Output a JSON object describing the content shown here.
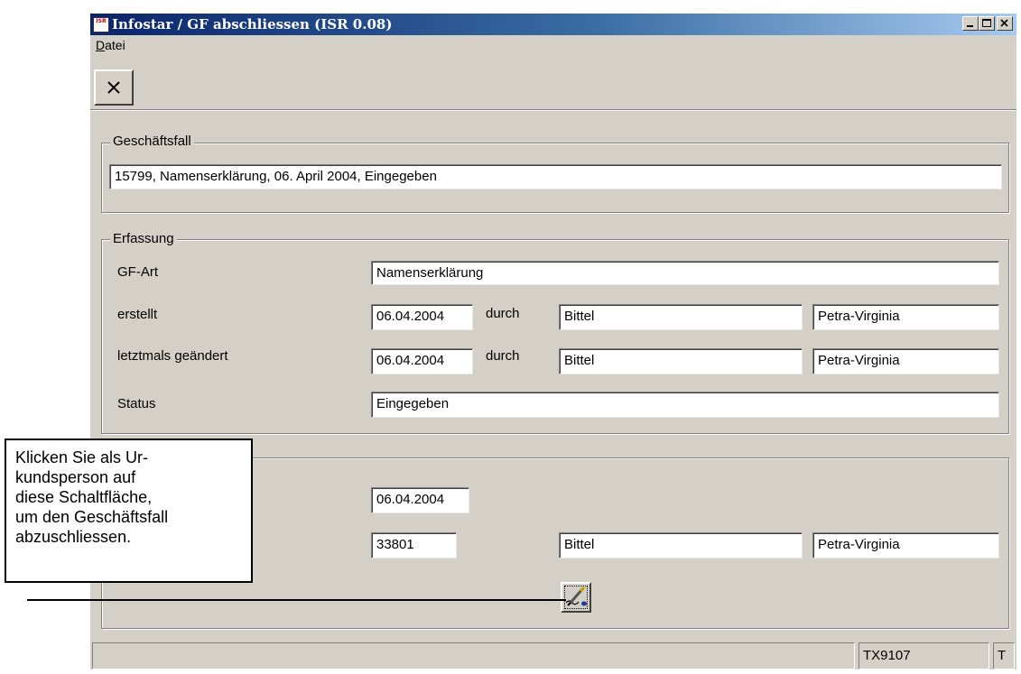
{
  "window": {
    "title": "Infostar / GF abschliessen (ISR 0.08)",
    "app_icon_text": "ISR",
    "controls": [
      "minimize-icon",
      "maximize-icon",
      "close-icon"
    ]
  },
  "menu": {
    "datei": "Datei"
  },
  "toolbar": {
    "close_tool_icon": "close-x-icon"
  },
  "geschaeftsfall": {
    "legend": "Geschäftsfall",
    "value": "15799, Namenserklärung, 06. April 2004, Eingegeben"
  },
  "erfassung": {
    "legend": "Erfassung",
    "gf_art": {
      "label": "GF-Art",
      "value": "Namenserklärung"
    },
    "erstellt": {
      "label": "erstellt",
      "date": "06.04.2004",
      "durch": "durch",
      "name": "Bittel",
      "vorname": "Petra-Virginia"
    },
    "geaendert": {
      "label": "letztmals geändert",
      "date": "06.04.2004",
      "durch": "durch",
      "name": "Bittel",
      "vorname": "Petra-Virginia"
    },
    "status": {
      "label": "Status",
      "value": "Eingegeben"
    }
  },
  "abschluss": {
    "date": "06.04.2004",
    "id": "33801",
    "name": "Bittel",
    "vorname": "Petra-Virginia",
    "sign_icon": "pen-sign-icon"
  },
  "statusbar": {
    "user": "TX9107",
    "mode": "T"
  },
  "callout": {
    "lines": [
      "Klicken Sie als Ur-",
      "kundsperson auf",
      "diese Schaltfläche,",
      "um den Geschäftsfall",
      "abzuschliessen."
    ]
  }
}
